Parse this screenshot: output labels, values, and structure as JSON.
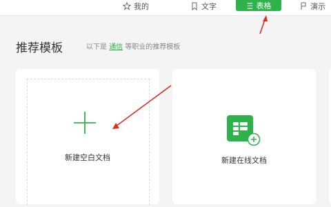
{
  "topbar": {
    "tabs": [
      {
        "label": "我的",
        "icon": "star-icon"
      },
      {
        "label": "文字",
        "icon": "bookmark-icon"
      },
      {
        "label": "表格",
        "icon": "sheet-icon",
        "active": true
      },
      {
        "label": "演示",
        "icon": "presentation-icon"
      }
    ]
  },
  "header": {
    "title": "推荐模板",
    "subtitle_prefix": "以下是",
    "subtitle_link": "通信",
    "subtitle_suffix": "等职业的推荐模板"
  },
  "cards": [
    {
      "label": "新建空白文档",
      "icon": "plus-icon"
    },
    {
      "label": "新建在线文档",
      "icon": "online-sheet-icon"
    }
  ],
  "colors": {
    "accent": "#2fb24c",
    "arrow": "#d93025"
  }
}
